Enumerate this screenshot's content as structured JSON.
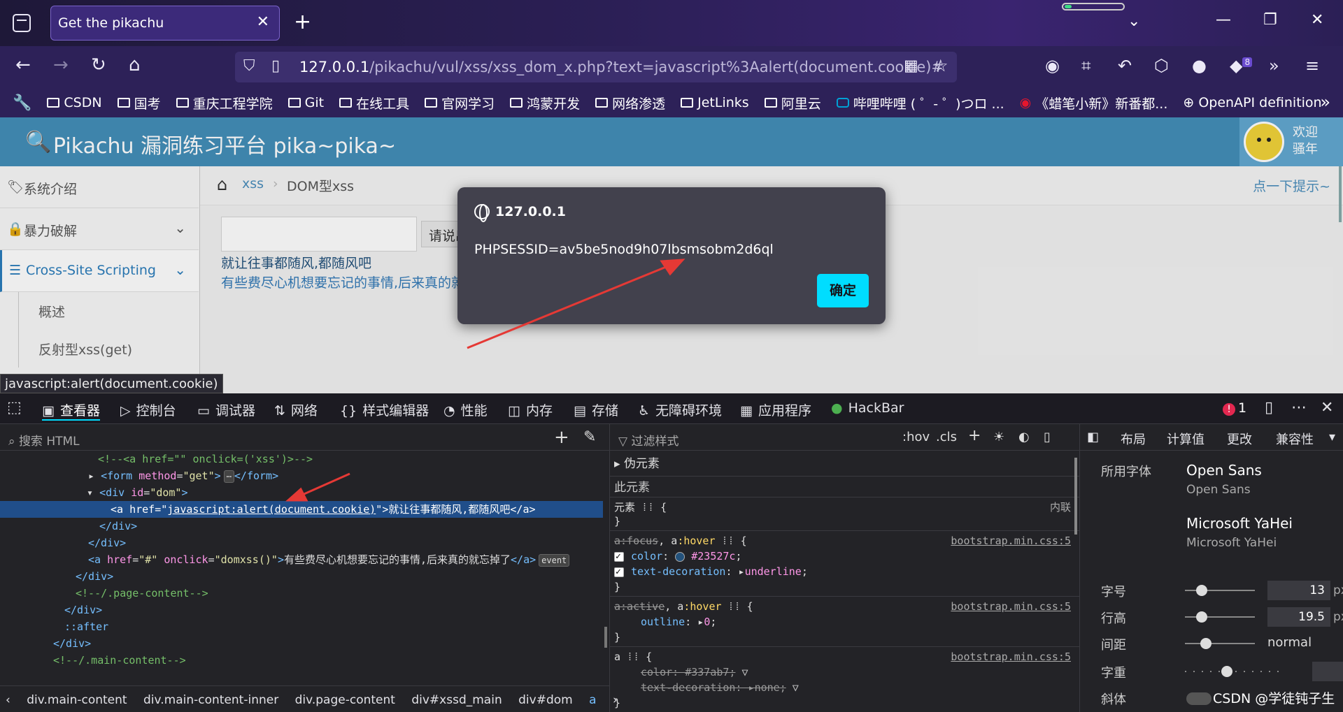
{
  "browser": {
    "tab_title": "Get the pikachu",
    "url_host": "127.0.0.1",
    "url_path": "/pikachu/vul/xss/xss_dom_x.php?text=javascript%3Aalert(document.cookie)#",
    "extension_badge": "8"
  },
  "bookmarks": [
    {
      "label": "CSDN",
      "icon": "folder-icon"
    },
    {
      "label": "国考",
      "icon": "folder-icon"
    },
    {
      "label": "重庆工程学院",
      "icon": "folder-icon"
    },
    {
      "label": "Git",
      "icon": "folder-icon"
    },
    {
      "label": "在线工具",
      "icon": "folder-icon"
    },
    {
      "label": "官网学习",
      "icon": "folder-icon"
    },
    {
      "label": "鸿蒙开发",
      "icon": "folder-icon"
    },
    {
      "label": "网络渗透",
      "icon": "folder-icon"
    },
    {
      "label": "JetLinks",
      "icon": "folder-icon"
    },
    {
      "label": "阿里云",
      "icon": "folder-icon"
    },
    {
      "label": "哔哩哔哩 ( ゜- ゜)つロ ...",
      "icon": "bilibili-icon"
    },
    {
      "label": "《蜡笔小新》新番都...",
      "icon": "weibo-icon"
    },
    {
      "label": "OpenAPI definition",
      "icon": "globe-icon"
    }
  ],
  "page": {
    "header_title": "Pikachu 漏洞练习平台 pika~pika~",
    "welcome_line1": "欢迎",
    "welcome_line2": "骚年",
    "sidebar": {
      "intro": "系统介绍",
      "brute": "暴力破解",
      "xss": "Cross-Site Scripting",
      "sub1": "概述",
      "sub2": "反射型xss(get)"
    },
    "breadcrumb_xss": "xss",
    "breadcrumb_current": "DOM型xss",
    "hint_link": "点一下提示~",
    "submit_label": "请说出你的伤心往事",
    "dom_link": "就让往事都随风,都随风吧",
    "forget_link": "有些费尽心机想要忘记的事情,后来真的就忘掉了",
    "status_url": "javascript:alert(document.cookie)"
  },
  "alert": {
    "host": "127.0.0.1",
    "message": "PHPSESSID=av5be5nod9h07lbsmsobm2d6ql",
    "ok_label": "确定"
  },
  "devtools": {
    "tabs": {
      "inspector": "查看器",
      "console": "控制台",
      "debugger": "调试器",
      "network": "网络",
      "style_editor": "样式编辑器",
      "performance": "性能",
      "memory": "内存",
      "storage": "存储",
      "accessibility": "无障碍环境",
      "application": "应用程序",
      "hackbar": "HackBar"
    },
    "error_count": "1",
    "search_placeholder": "搜索 HTML",
    "markup": {
      "l1": "<!--<a href=\"\" onclick=('xss')>-->",
      "l2_tag": "<form",
      "l2_attr": "method",
      "l2_val": "\"get\"",
      "l2_end": "</form>",
      "l3_tag": "<div",
      "l3_attr": "id",
      "l3_val": "\"dom\"",
      "l4_tag": "<a",
      "l4_attr": "href",
      "l4_val": "javascript:alert(document.cookie)",
      "l4_text": "就让往事都随风,都随风吧",
      "l5": "</div>",
      "l6": "</div>",
      "l7_href_val": "\"#\"",
      "l7_onclick_val": "\"domxss()\"",
      "l7_text": "有些费尽心机想要忘记的事情,后来真的就忘掉了",
      "l7_badge": "event",
      "l8": "</div>",
      "l9": "<!--/.page-content-->",
      "l10": "</div>",
      "l11": "::after",
      "l12": "</div>",
      "l13": "<!--/.main-content-->"
    },
    "path": [
      "div.main-content",
      "div.main-content-inner",
      "div.page-content",
      "div#xssd_main",
      "div#dom",
      "a"
    ],
    "rules": {
      "filter_placeholder": "过滤样式",
      "hov": ":hov",
      "cls": ".cls",
      "pseudo": "伪元素",
      "this_element": "此元素",
      "element": "元素",
      "inline": "内联",
      "r1_selector": "a:focus, a:hover",
      "r1_source": "bootstrap.min.css:5",
      "r1_color": "#23527c",
      "r1_decoration": "underline",
      "r2_selector": "a:active, a:hover",
      "r2_source": "bootstrap.min.css:5",
      "r2_outline": "0",
      "r3_selector": "a",
      "r3_source": "bootstrap.min.css:5",
      "r3_color": "#337ab7",
      "r3_decoration": "none"
    },
    "fonts_panel": {
      "tabs": [
        "布局",
        "计算值",
        "更改",
        "兼容性"
      ],
      "used_fonts_label": "所用字体",
      "font1": "Open Sans",
      "font1_sub": "Open Sans",
      "font2": "Microsoft YaHei",
      "font2_sub": "Microsoft YaHei",
      "size_label": "字号",
      "size_value": "13",
      "line_height_label": "行高",
      "line_height_value": "19.5",
      "spacing_label": "间距",
      "spacing_value": "normal",
      "weight_label": "字重",
      "italic_label": "斜体",
      "unit": "px"
    }
  },
  "watermark": "CSDN @学徒钝子生"
}
